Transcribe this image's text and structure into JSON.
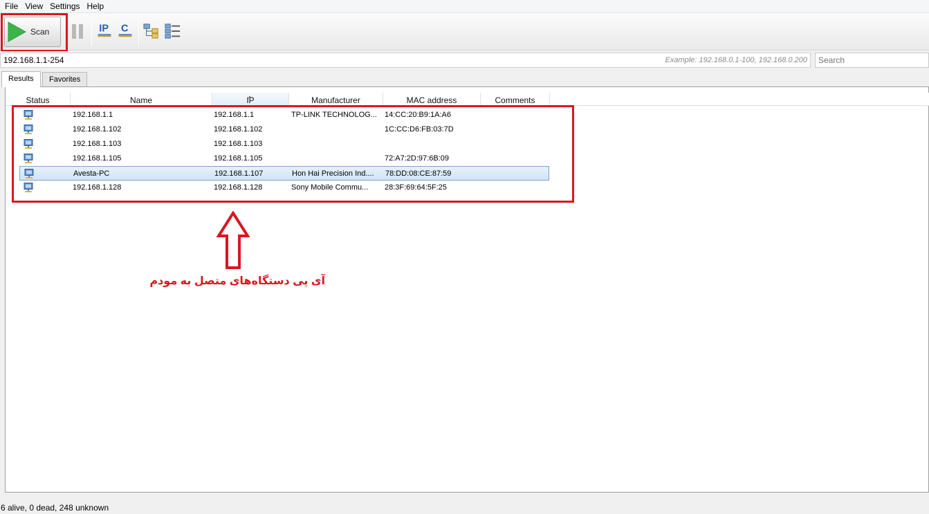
{
  "menu": [
    "File",
    "View",
    "Settings",
    "Help"
  ],
  "toolbar": {
    "scan_label": "Scan",
    "icons": [
      "play-icon",
      "pause-icon",
      "ip-icon",
      "c-icon",
      "network-tree-icon",
      "list-view-icon"
    ]
  },
  "range": {
    "value": "192.168.1.1-254",
    "example": "Example: 192.168.0.1-100, 192.168.0.200"
  },
  "search": {
    "placeholder": "Search"
  },
  "tabs": [
    "Results",
    "Favorites"
  ],
  "table": {
    "columns": [
      "Status",
      "Name",
      "IP",
      "Manufacturer",
      "MAC address",
      "Comments"
    ],
    "rows": [
      {
        "name": "192.168.1.1",
        "ip": "192.168.1.1",
        "manufacturer": "TP-LINK TECHNOLOG...",
        "mac": "14:CC:20:B9:1A:A6",
        "comments": ""
      },
      {
        "name": "192.168.1.102",
        "ip": "192.168.1.102",
        "manufacturer": "",
        "mac": "1C:CC:D6:FB:03:7D",
        "comments": ""
      },
      {
        "name": "192.168.1.103",
        "ip": "192.168.1.103",
        "manufacturer": "",
        "mac": "",
        "comments": ""
      },
      {
        "name": "192.168.1.105",
        "ip": "192.168.1.105",
        "manufacturer": "",
        "mac": "72:A7:2D:97:6B:09",
        "comments": ""
      },
      {
        "name": "Avesta-PC",
        "ip": "192.168.1.107",
        "manufacturer": "Hon Hai Precision Ind....",
        "mac": "78:DD:08:CE:87:59",
        "comments": ""
      },
      {
        "name": "192.168.1.128",
        "ip": "192.168.1.128",
        "manufacturer": "Sony Mobile Commu...",
        "mac": "28:3F:69:64:5F:25",
        "comments": ""
      }
    ],
    "selected_row": 4
  },
  "annotation": "آی پی دستگاه‌های متصل به مودم",
  "status": "6 alive, 0 dead, 248 unknown",
  "colors": {
    "highlight": "#d9171f",
    "play": "#3bb54a",
    "icon_blue": "#1f5fb3"
  }
}
